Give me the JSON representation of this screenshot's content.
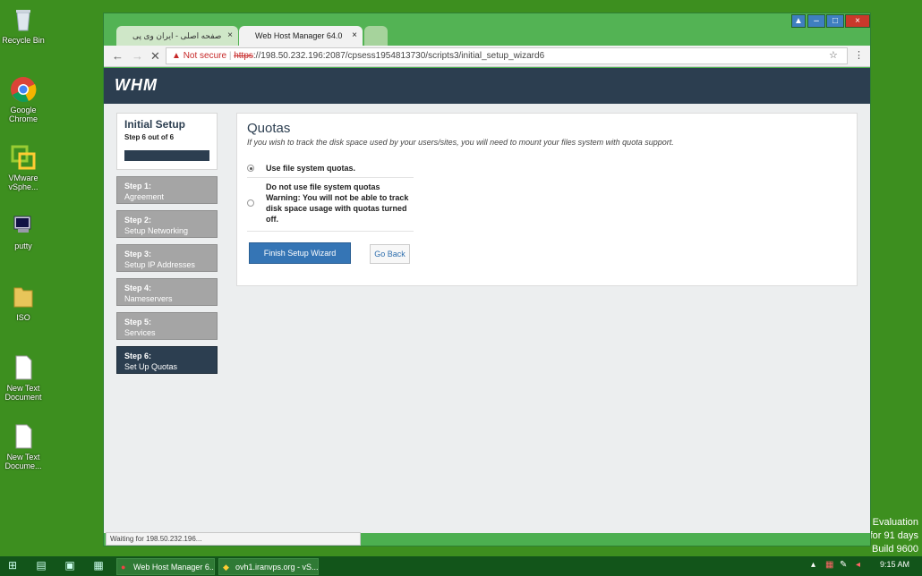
{
  "desktop": {
    "icons": [
      {
        "label": "Recycle Bin",
        "icon": "recycle-bin-icon"
      },
      {
        "label": "Google Chrome",
        "icon": "chrome-icon"
      },
      {
        "label": "VMware vSphe...",
        "icon": "vmware-icon"
      },
      {
        "label": "putty",
        "icon": "putty-icon"
      },
      {
        "label": "ISO",
        "icon": "folder-icon"
      },
      {
        "label": "New Text Document",
        "icon": "text-document-icon"
      },
      {
        "label": "New Text Docume...",
        "icon": "text-document-icon"
      }
    ],
    "evaluation": [
      "Evaluation",
      "for 91 days",
      "Build 9600"
    ]
  },
  "browser": {
    "tabs": [
      {
        "label": "صفحه اصلی - ایران وی پی",
        "close": "×"
      },
      {
        "label": "Web Host Manager 64.0",
        "close": "×"
      }
    ],
    "security_label": "Not secure",
    "url_scheme": "https",
    "url_rest": "://198.50.232.196:2087/cpsess1954813730/scripts3/initial_setup_wizard6",
    "status_text": "Waiting for 198.50.232.196..."
  },
  "whm": {
    "logo": "WHM",
    "sidebar": {
      "title": "Initial Setup",
      "subtitle": "Step 6 out of 6",
      "progress": 1.0,
      "steps": [
        {
          "num": "Step 1:",
          "label": "Agreement"
        },
        {
          "num": "Step 2:",
          "label": "Setup Networking"
        },
        {
          "num": "Step 3:",
          "label": "Setup IP Addresses"
        },
        {
          "num": "Step 4:",
          "label": "Nameservers"
        },
        {
          "num": "Step 5:",
          "label": "Services"
        },
        {
          "num": "Step 6:",
          "label": "Set Up Quotas"
        }
      ]
    },
    "main": {
      "title": "Quotas",
      "description": "If you wish to track the disk space used by your users/sites, you will need to mount your files system with quota support.",
      "options": [
        {
          "label": "Use file system quotas.",
          "selected": true
        },
        {
          "label": "Do not use file system quotas Warning: You will not be able to track disk space usage with quotas turned off.",
          "selected": false
        }
      ],
      "finish_label": "Finish Setup Wizard",
      "goback_label": "Go Back"
    }
  },
  "taskbar": {
    "items": [
      {
        "label": "Web Host Manager 6..."
      },
      {
        "label": "ovh1.iranvps.org - vS..."
      }
    ],
    "clock": "9:15 AM"
  },
  "colors": {
    "desktop": "#3d8f1f",
    "whm_bar": "#2c3e50",
    "button_primary": "#3575b5"
  }
}
